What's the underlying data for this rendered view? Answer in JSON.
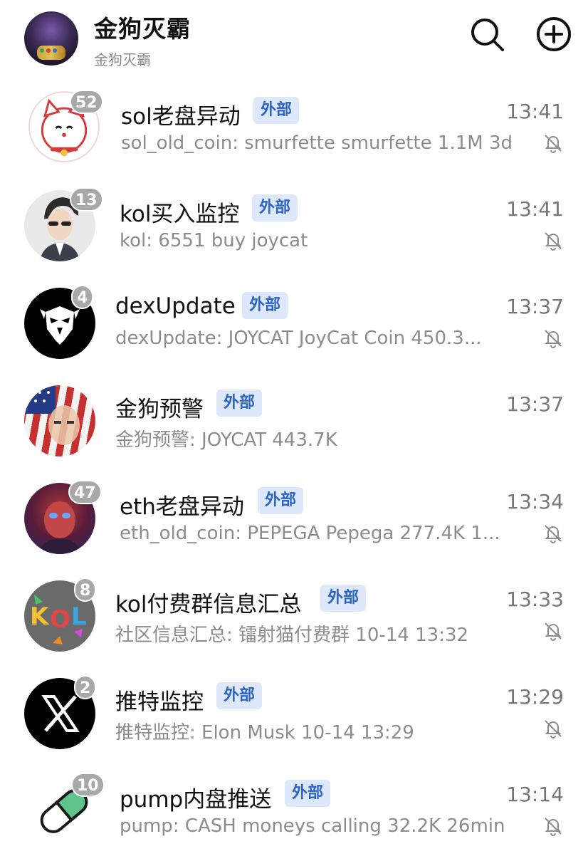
{
  "header": {
    "title": "金狗灭霸",
    "subtitle": "金狗灭霸",
    "actions": [
      "search-icon",
      "add-circle-icon"
    ]
  },
  "colors": {
    "tag_bg": "#dde8fb",
    "tag_text": "#2d63c8",
    "badge_bg": "#a8a8a8",
    "muted_text": "#8c8c8c"
  },
  "chats": [
    {
      "name": "sol老盘异动",
      "tag": "外部",
      "time": "13:41",
      "preview": "sol_old_coin: smurfette smurfette 1.1M 3d",
      "badge": "52",
      "muted": true,
      "avatar": "lucky-cat-avatar"
    },
    {
      "name": "kol买入监控",
      "tag": "外部",
      "time": "13:41",
      "preview": "kol: 6551 buy joycat",
      "badge": "13",
      "muted": true,
      "avatar": "anime-man-avatar"
    },
    {
      "name": "dexUpdate",
      "tag": "外部",
      "time": "13:37",
      "preview": "dexUpdate: JOYCAT JoyCat Coin 450.3...",
      "badge": "4",
      "muted": true,
      "avatar": "eagle-avatar"
    },
    {
      "name": "金狗预警",
      "tag": "外部",
      "time": "13:37",
      "preview": "金狗预警: JOYCAT 443.7K",
      "badge": "",
      "muted": false,
      "avatar": "flag-face-avatar"
    },
    {
      "name": "eth老盘异动",
      "tag": "外部",
      "time": "13:34",
      "preview": "eth_old_coin: PEPEGA Pepega 277.4K 1...",
      "badge": "47",
      "muted": true,
      "avatar": "red-face-avatar"
    },
    {
      "name": "kol付费群信息汇总",
      "tag": "外部",
      "time": "13:33",
      "preview": "社区信息汇总: 镭射猫付费群 10-14 13:32",
      "badge": "8",
      "muted": true,
      "avatar": "kol-letters-avatar"
    },
    {
      "name": "推特监控",
      "tag": "外部",
      "time": "13:29",
      "preview": "推特监控: Elon Musk 10-14 13:29",
      "badge": "2",
      "muted": true,
      "avatar": "x-logo-avatar"
    },
    {
      "name": "pump内盘推送",
      "tag": "外部",
      "time": "13:14",
      "preview": "pump: CASH moneys calling 32.2K 26min",
      "badge": "10",
      "muted": true,
      "avatar": "pill-avatar"
    }
  ]
}
